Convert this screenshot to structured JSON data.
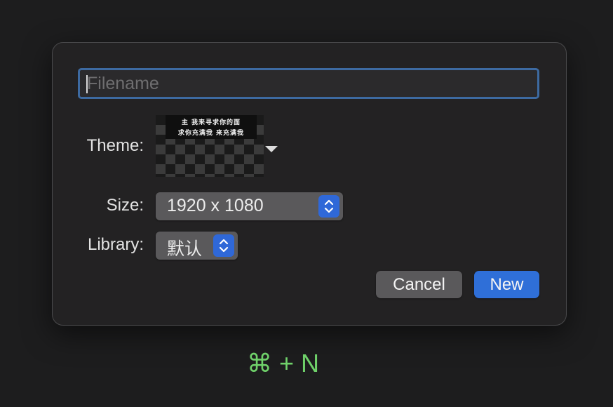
{
  "dialog": {
    "filename": {
      "value": "",
      "placeholder": "Filename"
    },
    "theme": {
      "label": "Theme:",
      "thumbnail_text_line1": "主 我来寻求你的面",
      "thumbnail_text_line2": "求你充满我 来充满我",
      "dropdown_icon": "triangle-down-icon"
    },
    "size": {
      "label": "Size:",
      "selected": "1920 x 1080"
    },
    "library": {
      "label": "Library:",
      "selected": "默认"
    },
    "buttons": {
      "cancel": "Cancel",
      "new": "New"
    },
    "colors": {
      "accent": "#2f6fd8",
      "focus_ring": "#3d6aa1",
      "shortcut": "#6fd16a"
    }
  },
  "shortcut_hint": "⌘ + N"
}
